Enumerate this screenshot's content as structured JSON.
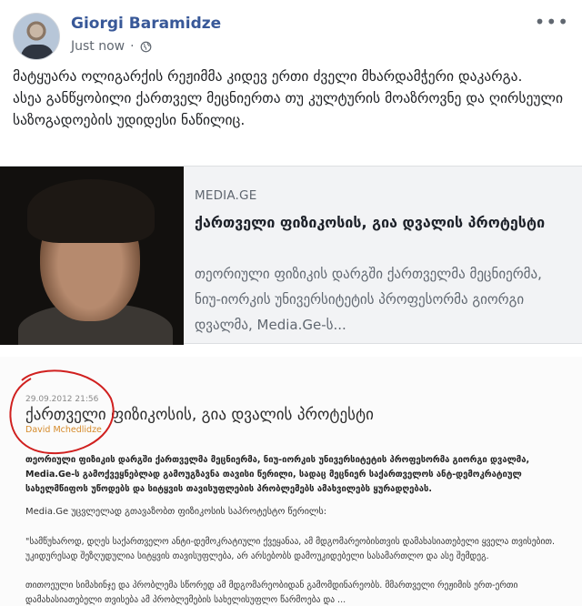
{
  "post": {
    "author": "Giorgi Baramidze",
    "timestamp": "Just now",
    "privacy_icon": "globe-icon",
    "more_icon": "more-dots-icon",
    "text": "მატყუარა ოლიგარქის რეჟიმმა კიდევ ერთი ძველი მხარდამჭერი დაკარგა.\nასეა განწყობილი ქართველ მეცნიერთა თუ კულტურის მოაზროვნე და ღირსეული საზოგადოების უდიდესი ნაწილიც."
  },
  "link_card": {
    "domain": "MEDIA.GE",
    "title": "ქართველი ფიზიკოსის, გია დვალის პროტესტი",
    "description": "თეორიული ფიზიკის დარგში ქართველმა მეცნიერმა, ნიუ-იორკის უნივერსიტეტის პროფესორმა გიორგი დვალმა, Media.Ge-ს..."
  },
  "article_scan": {
    "date": "29.09.2012 21:56",
    "title": "ქართველი ფიზიკოსის, გია დვალის პროტესტი",
    "author": "David Mchedlidze",
    "lead": "თეორიული ფიზიკის დარგში ქართველმა მეცნიერმა, ნიუ-იორკის უნივერსიტეტის პროფესორმა გიორგი დვალმა, Media.Ge-ს გამოქვეყნებლად გამოუგზავნა თავისი წერილი, სადაც მეცნიერ საქართველოს ანტ-დემოკრატიულ სახელმწიფოს უწოდებს და სიტყვის თავისუფლების პრობლემებს ამახვილებს ყურადღებას.",
    "p1": "Media.Ge უცვლელად გთავაზობთ ფიზიკოსის საპროტესტო წერილს:",
    "p2": "\"სამწუხაროდ, დღეს საქართველო ანტი-დემოკრატიული ქვეყანაა, ამ მდგომარეობისთვის დამახასიათებელი ყველა თვისებით. უკიდურესად შეზღუდულია სიტყვის თავისუფლება, არ არსებობს დამოუკიდებელი სასამართლო და ასე შემდეგ.",
    "p3": "თითოეული სიმახინჯე და პრობლემა სწორედ ამ მდგომარეობიდან გამომდინარეობს. მმართველი რეჟიმის ერთ-ერთი დამახასიათებელი თვისება ამ პრობლემების სახელისუფლო წარმოება და ..."
  },
  "colors": {
    "author_link": "#385898",
    "annotation_circle": "#d0201f",
    "scan_author": "#d58a2a"
  }
}
